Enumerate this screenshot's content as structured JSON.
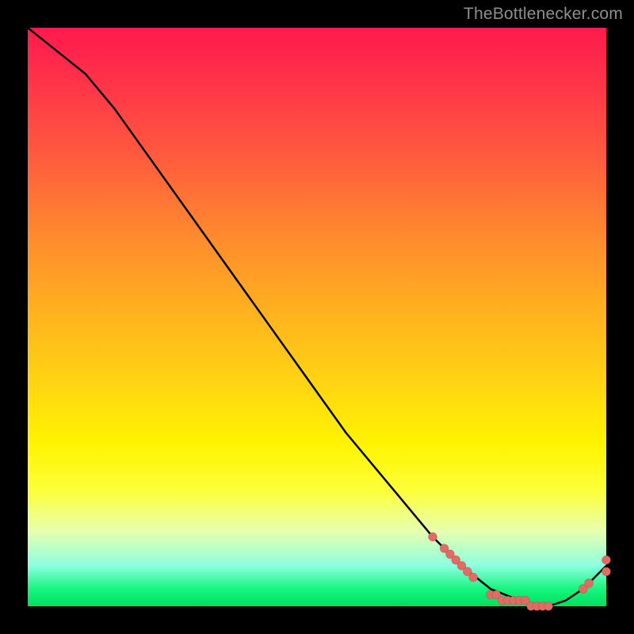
{
  "attribution": "TheBottlenecker.com",
  "colors": {
    "gradient_top": "#ff1a4d",
    "gradient_mid": "#fff400",
    "gradient_bottom": "#00e060",
    "curve": "#000000",
    "points": "#e46a64",
    "background": "#000000"
  },
  "chart_data": {
    "type": "line",
    "title": "",
    "xlabel": "",
    "ylabel": "",
    "xlim": [
      0,
      100
    ],
    "ylim": [
      0,
      100
    ],
    "grid": false,
    "series": [
      {
        "name": "bottleneck-curve",
        "x": [
          0,
          5,
          10,
          15,
          20,
          25,
          30,
          35,
          40,
          45,
          50,
          55,
          60,
          65,
          70,
          75,
          80,
          85,
          88,
          90,
          93,
          96,
          100
        ],
        "y": [
          100,
          96,
          92,
          86,
          79,
          72,
          65,
          58,
          51,
          44,
          37,
          30,
          24,
          18,
          12,
          7,
          3,
          1,
          0,
          0,
          1,
          3,
          7
        ]
      }
    ],
    "points": [
      {
        "name": "cluster-falling-a",
        "x": 70,
        "y": 12
      },
      {
        "name": "cluster-falling-b",
        "x": 72,
        "y": 10
      },
      {
        "name": "cluster-falling-c",
        "x": 73,
        "y": 9
      },
      {
        "name": "cluster-falling-d",
        "x": 74,
        "y": 8
      },
      {
        "name": "cluster-falling-e",
        "x": 75,
        "y": 7
      },
      {
        "name": "cluster-falling-f",
        "x": 76,
        "y": 6
      },
      {
        "name": "cluster-falling-g",
        "x": 77,
        "y": 5
      },
      {
        "name": "bottom-a",
        "x": 80,
        "y": 2
      },
      {
        "name": "bottom-b",
        "x": 81,
        "y": 2
      },
      {
        "name": "bottom-c",
        "x": 82,
        "y": 1
      },
      {
        "name": "bottom-d",
        "x": 83,
        "y": 1
      },
      {
        "name": "bottom-e",
        "x": 84,
        "y": 1
      },
      {
        "name": "bottom-f",
        "x": 85,
        "y": 1
      },
      {
        "name": "bottom-g",
        "x": 86,
        "y": 1
      },
      {
        "name": "bottom-h",
        "x": 87,
        "y": 0
      },
      {
        "name": "bottom-i",
        "x": 88,
        "y": 0
      },
      {
        "name": "bottom-j",
        "x": 89,
        "y": 0
      },
      {
        "name": "bottom-k",
        "x": 90,
        "y": 0
      },
      {
        "name": "rising-a",
        "x": 96,
        "y": 3
      },
      {
        "name": "rising-b",
        "x": 97,
        "y": 4
      },
      {
        "name": "endpoint-a",
        "x": 100,
        "y": 6
      },
      {
        "name": "endpoint-b",
        "x": 100,
        "y": 8
      }
    ]
  }
}
